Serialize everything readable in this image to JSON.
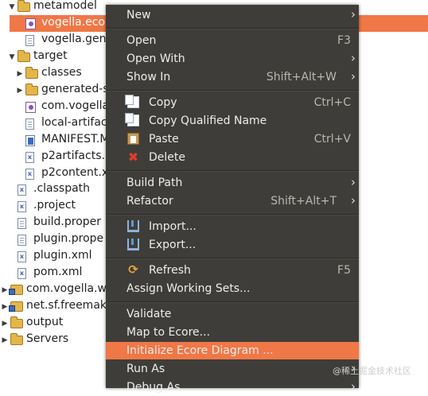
{
  "tree": [
    {
      "label": "metamodel",
      "icon": "folder",
      "arrow": "expanded",
      "level": 1
    },
    {
      "label": "vogella.eco",
      "icon": "ecore-file",
      "arrow": "none",
      "level": 2,
      "selected": true
    },
    {
      "label": "vogella.gen",
      "icon": "genmodel-file",
      "arrow": "none",
      "level": 2
    },
    {
      "label": "target",
      "icon": "folder",
      "arrow": "expanded",
      "level": 1
    },
    {
      "label": "classes",
      "icon": "folder",
      "arrow": "collapsed",
      "level": 2
    },
    {
      "label": "generated-s",
      "icon": "folder",
      "arrow": "collapsed",
      "level": 2
    },
    {
      "label": "com.vogella",
      "icon": "jar-file",
      "arrow": "none",
      "level": 2
    },
    {
      "label": "local-artifac",
      "icon": "file",
      "arrow": "none",
      "level": 2
    },
    {
      "label": "MANIFEST.M",
      "icon": "manifest-file",
      "arrow": "none",
      "level": 2
    },
    {
      "label": "p2artifacts.",
      "icon": "xml-file",
      "arrow": "none",
      "level": 2
    },
    {
      "label": "p2content.x",
      "icon": "xml-file",
      "arrow": "none",
      "level": 2
    },
    {
      "label": ".classpath",
      "icon": "xml-file",
      "arrow": "none",
      "level": 1
    },
    {
      "label": ".project",
      "icon": "xml-file",
      "arrow": "none",
      "level": 1
    },
    {
      "label": "build.proper",
      "icon": "file",
      "arrow": "none",
      "level": 1
    },
    {
      "label": "plugin.prope",
      "icon": "file",
      "arrow": "none",
      "level": 1
    },
    {
      "label": "plugin.xml",
      "icon": "xml-file",
      "arrow": "none",
      "level": 1
    },
    {
      "label": "pom.xml",
      "icon": "xml-file",
      "arrow": "none",
      "level": 1
    },
    {
      "label": "com.vogella.w",
      "icon": "project",
      "arrow": "collapsed",
      "level": 0
    },
    {
      "label": "net.sf.freemak",
      "icon": "project",
      "arrow": "collapsed",
      "level": 0
    },
    {
      "label": "output",
      "icon": "folder",
      "arrow": "collapsed",
      "level": 0
    },
    {
      "label": "Servers",
      "icon": "folder",
      "arrow": "collapsed",
      "level": 0
    }
  ],
  "menu": [
    {
      "label": "New",
      "sub": true
    },
    {
      "sep": true
    },
    {
      "label": "Open",
      "accel": "F3"
    },
    {
      "label": "Open With",
      "sub": true
    },
    {
      "label": "Show In",
      "accel": "Shift+Alt+W",
      "sub": true
    },
    {
      "sep": true
    },
    {
      "label": "Copy",
      "accel": "Ctrl+C",
      "icon": "copy-icon"
    },
    {
      "label": "Copy Qualified Name",
      "icon": "copy-qualified-icon"
    },
    {
      "label": "Paste",
      "accel": "Ctrl+V",
      "icon": "paste-icon"
    },
    {
      "label": "Delete",
      "icon": "delete-icon"
    },
    {
      "sep": true
    },
    {
      "label": "Build Path",
      "sub": true
    },
    {
      "label": "Refactor",
      "accel": "Shift+Alt+T",
      "sub": true
    },
    {
      "sep": true
    },
    {
      "label": "Import...",
      "icon": "import-icon"
    },
    {
      "label": "Export...",
      "icon": "export-icon"
    },
    {
      "sep": true
    },
    {
      "label": "Refresh",
      "accel": "F5",
      "icon": "refresh-icon"
    },
    {
      "label": "Assign Working Sets..."
    },
    {
      "sep": true
    },
    {
      "label": "Validate"
    },
    {
      "label": "Map to Ecore..."
    },
    {
      "label": "Initialize Ecore Diagram ...",
      "highlight": true
    },
    {
      "label": "Run As",
      "sub": true
    },
    {
      "label": "Debug As",
      "sub": true
    }
  ],
  "watermark": "@稀土掘金技术社区",
  "colors": {
    "selection": "#f07746",
    "menu_bg": "#3e3d39",
    "menu_text": "#ededed"
  }
}
